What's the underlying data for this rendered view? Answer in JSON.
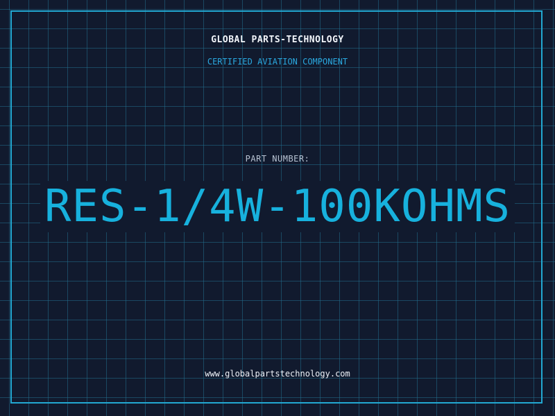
{
  "label": {
    "brand": "GLOBAL PARTS-TECHNOLOGY",
    "tagline": "CERTIFIED AVIATION COMPONENT",
    "part_number_label": "PART NUMBER:",
    "part_number": "RES-1/4W-100KOHMS",
    "website": "www.globalpartstechnology.com"
  },
  "colors": {
    "background": "#111a2e",
    "grid": "#226e8c",
    "frame": "#22a8d2",
    "accent": "#17b1dd"
  }
}
